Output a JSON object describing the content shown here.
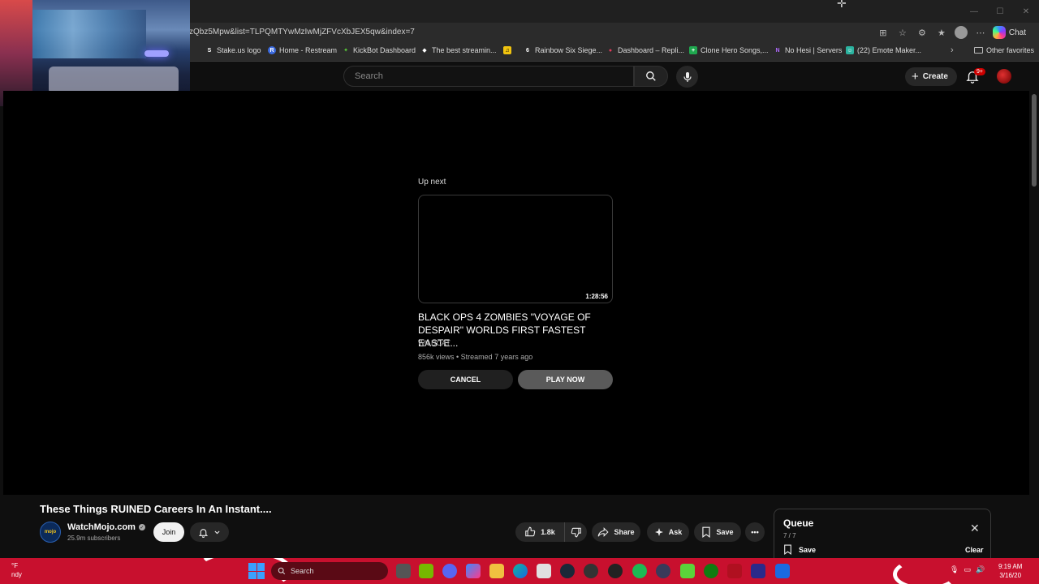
{
  "browser": {
    "url": "zQbz5Mpw&list=TLPQMTYwMzIwMjZFVcXbJEX5qw&index=7",
    "chat_label": "Chat",
    "bookmarks": [
      {
        "label": "Stake.us logo",
        "fav": "S",
        "color": "#2b2b2b"
      },
      {
        "label": "Home - Restream",
        "fav": "R",
        "color": "#3a6ae0"
      },
      {
        "label": "KickBot Dashboard",
        "fav": "✦",
        "color": "#5bd33a"
      },
      {
        "label": "The best streamin...",
        "fav": "◆",
        "color": "#2b2b2b"
      },
      {
        "label": "",
        "fav": "♫",
        "color": "#f1c40f"
      },
      {
        "label": "Rainbow Six Siege...",
        "fav": "6",
        "color": "#2b2b2b"
      },
      {
        "label": "Dashboard – Repli...",
        "fav": "●",
        "color": "#e03a5a"
      },
      {
        "label": "Clone Hero Songs,...",
        "fav": "+",
        "color": "#1fa84f"
      },
      {
        "label": "No Hesi | Servers",
        "fav": "N",
        "color": "#8a3ae0"
      },
      {
        "label": "(22) Emote Maker...",
        "fav": "☺",
        "color": "#2bb3a0"
      }
    ],
    "other_favorites": "Other favorites"
  },
  "youtube": {
    "search_placeholder": "Search",
    "create_label": "Create",
    "notification_badge": "9+"
  },
  "up_next": {
    "label": "Up next",
    "duration": "1:28:56",
    "title": "BLACK OPS 4 ZOMBIES \"VOYAGE OF DESPAIR\" WORLDS FIRST FASTEST EASTE...",
    "channel": "WILDCAT",
    "meta": "856k views • Streamed 7 years ago",
    "cancel_label": "CANCEL",
    "play_label": "PLAY NOW"
  },
  "video": {
    "title": "These Things RUINED Careers In An Instant....",
    "channel_name": "WatchMojo.com",
    "channel_logo_text": "mojo",
    "subscribers": "25.9m subscribers",
    "join_label": "Join",
    "likes": "1.8k",
    "share_label": "Share",
    "ask_label": "Ask",
    "save_label": "Save"
  },
  "queue": {
    "title": "Queue",
    "count": "7 / 7",
    "save_label": "Save",
    "clear_label": "Clear"
  },
  "taskbar": {
    "weather_temp": "°F",
    "weather_desc": "ndy",
    "search_label": "Search",
    "time": "9:19 AM",
    "date": "3/16/20"
  }
}
